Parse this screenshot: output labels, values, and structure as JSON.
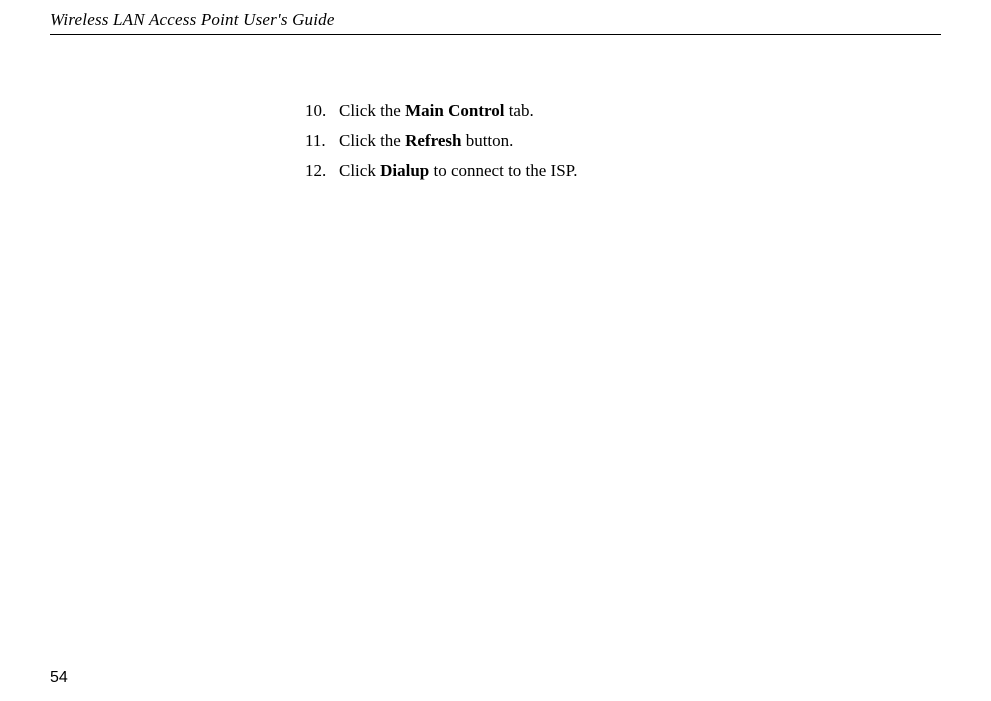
{
  "header": {
    "title": "Wireless LAN Access Point User's Guide"
  },
  "steps": [
    {
      "number": "10.",
      "prefix": "Click the ",
      "bold": "Main Control",
      "suffix": " tab."
    },
    {
      "number": "11.",
      "prefix": "Click the ",
      "bold": "Refresh",
      "suffix": " button."
    },
    {
      "number": "12.",
      "prefix": "Click ",
      "bold": "Dialup",
      "suffix": " to connect to the ISP."
    }
  ],
  "page_number": "54"
}
